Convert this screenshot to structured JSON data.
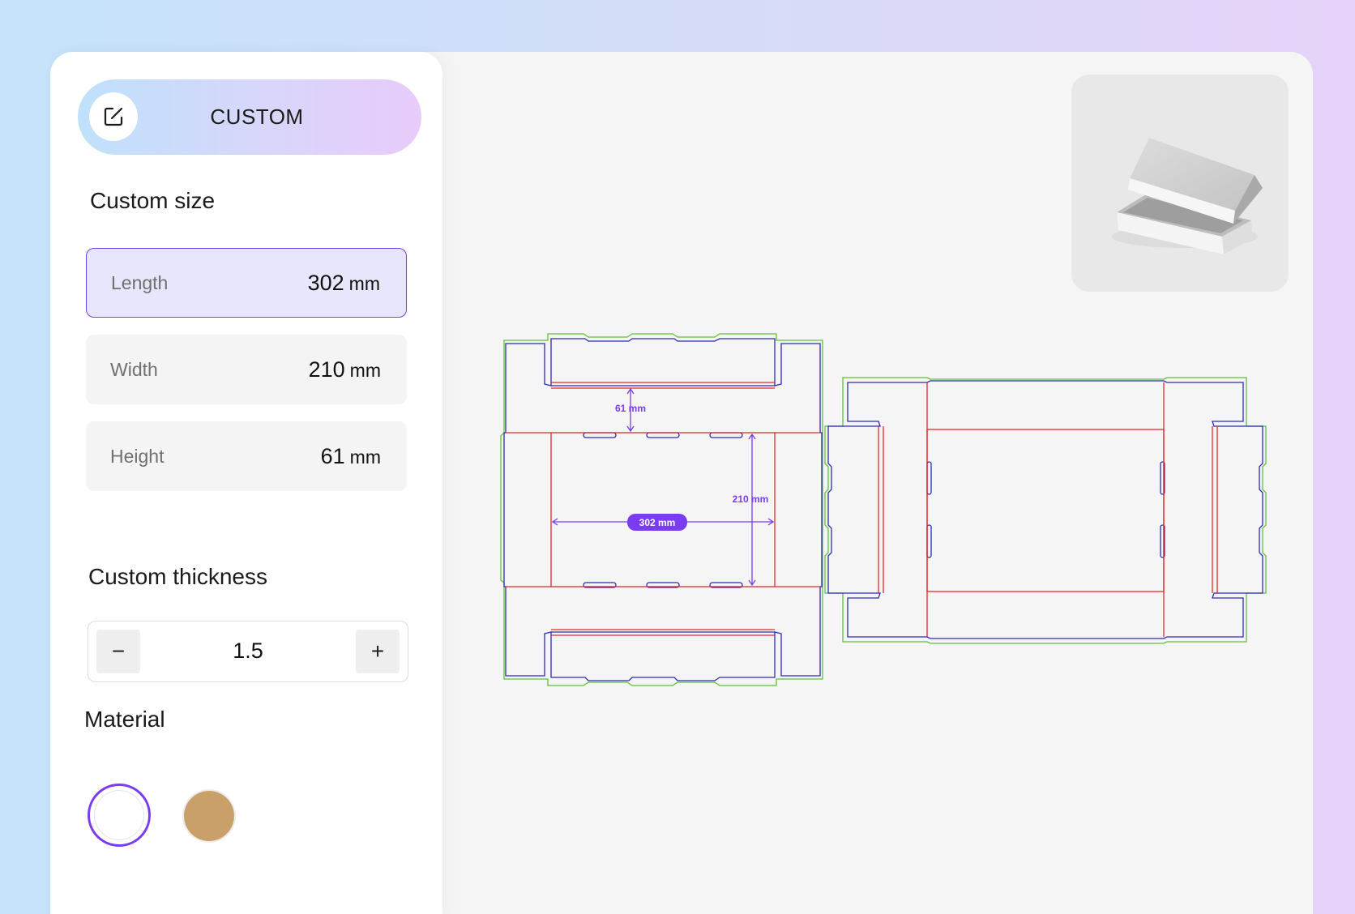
{
  "mode": {
    "label": "CUSTOM",
    "icon": "edit-icon"
  },
  "custom_size": {
    "title": "Custom size",
    "fields": [
      {
        "label": "Length",
        "value": "302",
        "unit": "mm",
        "active": true
      },
      {
        "label": "Width",
        "value": "210",
        "unit": "mm",
        "active": false
      },
      {
        "label": "Height",
        "value": "61",
        "unit": "mm",
        "active": false
      }
    ]
  },
  "thickness": {
    "title": "Custom thickness",
    "value": "1.5",
    "decrement_label": "−",
    "increment_label": "+"
  },
  "material": {
    "title": "Material",
    "options": [
      {
        "name": "white",
        "color": "#ffffff",
        "selected": true
      },
      {
        "name": "kraft",
        "color": "#c9a06a",
        "selected": false
      }
    ]
  },
  "dieline": {
    "height_label": "61 mm",
    "width_label": "210 mm",
    "length_label": "302 mm",
    "colors": {
      "cut": "#2b2bb8",
      "fold": "#e02b2b",
      "bleed": "#5cc23a",
      "dimension": "#7a3cf0"
    }
  },
  "colors": {
    "accent": "#7a3cf0",
    "active_field_bg": "#e8e6fd"
  }
}
